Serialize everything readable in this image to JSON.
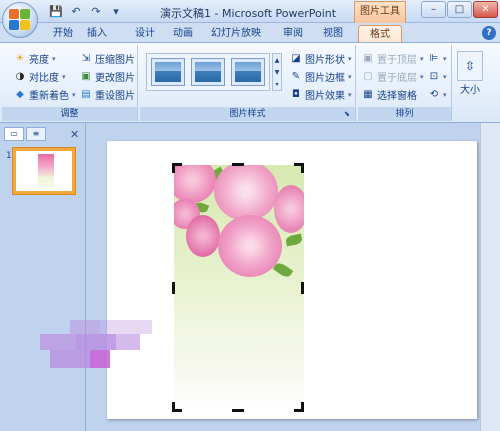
{
  "window": {
    "title": "演示文稿1 - Microsoft PowerPoint",
    "context_title": "图片工具",
    "controls": {
      "minimize": "–",
      "maximize": "□",
      "close": "✕"
    }
  },
  "quick_access": {
    "save_icon": "💾",
    "undo_icon": "↶",
    "redo_icon": "↷",
    "more_icon": "▾"
  },
  "tabs": [
    {
      "label": "开始",
      "active": false
    },
    {
      "label": "插入",
      "active": false
    },
    {
      "label": "设计",
      "active": false
    },
    {
      "label": "动画",
      "active": false
    },
    {
      "label": "幻灯片放映",
      "active": false
    },
    {
      "label": "审阅",
      "active": false
    },
    {
      "label": "视图",
      "active": false
    },
    {
      "label": "格式",
      "active": true,
      "contextual": true
    }
  ],
  "help_label": "?",
  "ribbon": {
    "adjust": {
      "label": "调整",
      "brightness": "亮度",
      "contrast": "对比度",
      "recolor": "重新着色",
      "compress": "压缩图片",
      "change": "更改图片",
      "reset": "重设图片"
    },
    "styles": {
      "label": "图片样式",
      "shape": "图片形状",
      "border": "图片边框",
      "effects": "图片效果"
    },
    "arrange": {
      "label": "排列",
      "bring_front": "置于顶层",
      "send_back": "置于底层",
      "selection_pane": "选择窗格"
    },
    "size": {
      "label": "大小"
    }
  },
  "slide_pane": {
    "tab_slides": "▭",
    "tab_outline": "≡",
    "close": "✕",
    "slide_number": "1"
  },
  "colors": {
    "ribbon_bg": "#dbe8f8",
    "accent": "#15428b",
    "context_tab": "#f6c59d",
    "selected_thumb": "#f4a83d",
    "blossom": "#e86aa8"
  }
}
